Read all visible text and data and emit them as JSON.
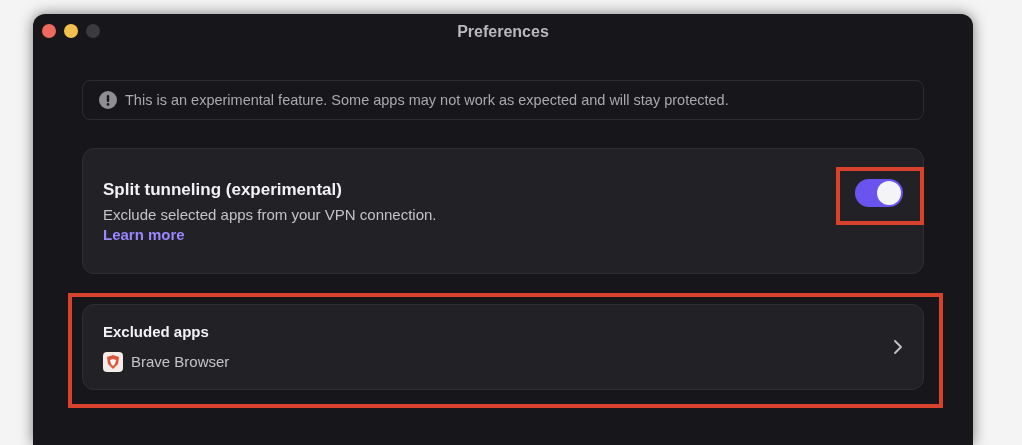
{
  "window": {
    "title": "Preferences",
    "controls": [
      {
        "kind": "close"
      },
      {
        "kind": "minimize"
      },
      {
        "kind": "zoom",
        "disabled": true
      }
    ]
  },
  "notice": {
    "text": "This is an experimental feature. Some apps may not work as expected and will stay protected."
  },
  "split_tunneling": {
    "title": "Split tunneling (experimental)",
    "description": "Exclude selected apps from your VPN connection.",
    "link": "Learn more",
    "on": true,
    "highlighted": true
  },
  "excluded_apps": {
    "title": "Excluded apps",
    "apps": [
      {
        "name": "Brave Browser"
      }
    ],
    "highlighted": true
  }
}
